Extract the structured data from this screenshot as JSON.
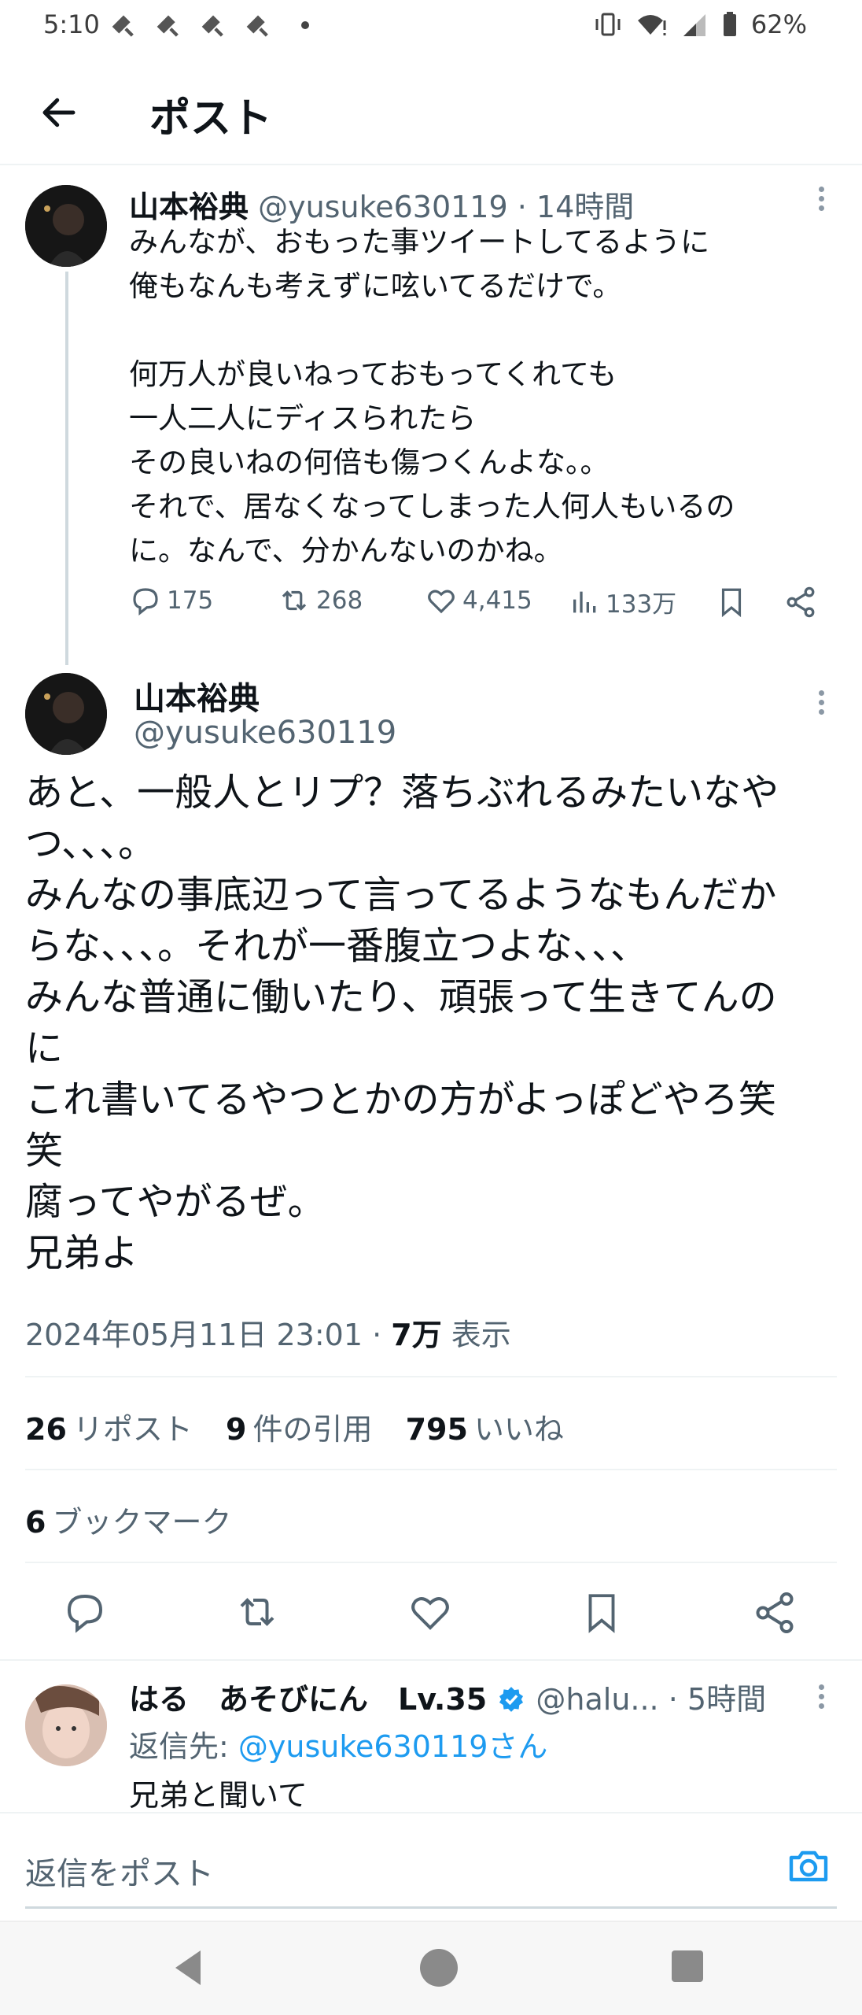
{
  "status_bar": {
    "time": "5:10",
    "battery": "62%"
  },
  "header": {
    "title": "ポスト"
  },
  "parent_post": {
    "name": "山本裕典",
    "handle": "@yusuke630119",
    "time": "· 14時間",
    "text": "みんなが、おもった事ツイートしてるように\n俺もなんも考えずに呟いてるだけで。\n\n何万人が良いねっておもってくれても\n一人二人にディスられたら\nその良いねの何倍も傷つくんよな。。\nそれで、居なくなってしまった人何人もいるの\nに。なんで、分かんないのかね。",
    "replies": "175",
    "reposts": "268",
    "likes": "4,415",
    "views": "133万"
  },
  "main_post": {
    "name": "山本裕典",
    "handle": "@yusuke630119",
    "text": "あと、一般人とリプ？落ちぶれるみたいなや\nつ、、、。\nみんなの事底辺って言ってるようなもんだか\nらな、、、。それが一番腹立つよな、、、\nみんな普通に働いたり、頑張って生きてんの\nに\nこれ書いてるやつとかの方がよっぽどやろ笑\n笑\n腐ってやがるぜ。\n兄弟よ",
    "date": "2024年05月11日 23:01 · ",
    "views_count": "7万",
    "views_label": " 表示",
    "reposts_count": "26",
    "reposts_label": "リポスト",
    "quotes_count": "9",
    "quotes_label": "件の引用",
    "likes_count": "795",
    "likes_label": "いいね",
    "bookmarks_count": "6",
    "bookmarks_label": "ブックマーク"
  },
  "reply": {
    "name": "はる　あそびにん　Lv.35",
    "handle": "@halu...",
    "time": "· 5時間",
    "reply_to_prefix": "返信先: ",
    "reply_to_user": "@yusuke630119さん",
    "text": "兄弟と聞いて"
  },
  "compose": {
    "placeholder": "返信をポスト"
  },
  "colors": {
    "accent": "#1d9bf0",
    "text": "#0f1419",
    "muted": "#536471"
  }
}
